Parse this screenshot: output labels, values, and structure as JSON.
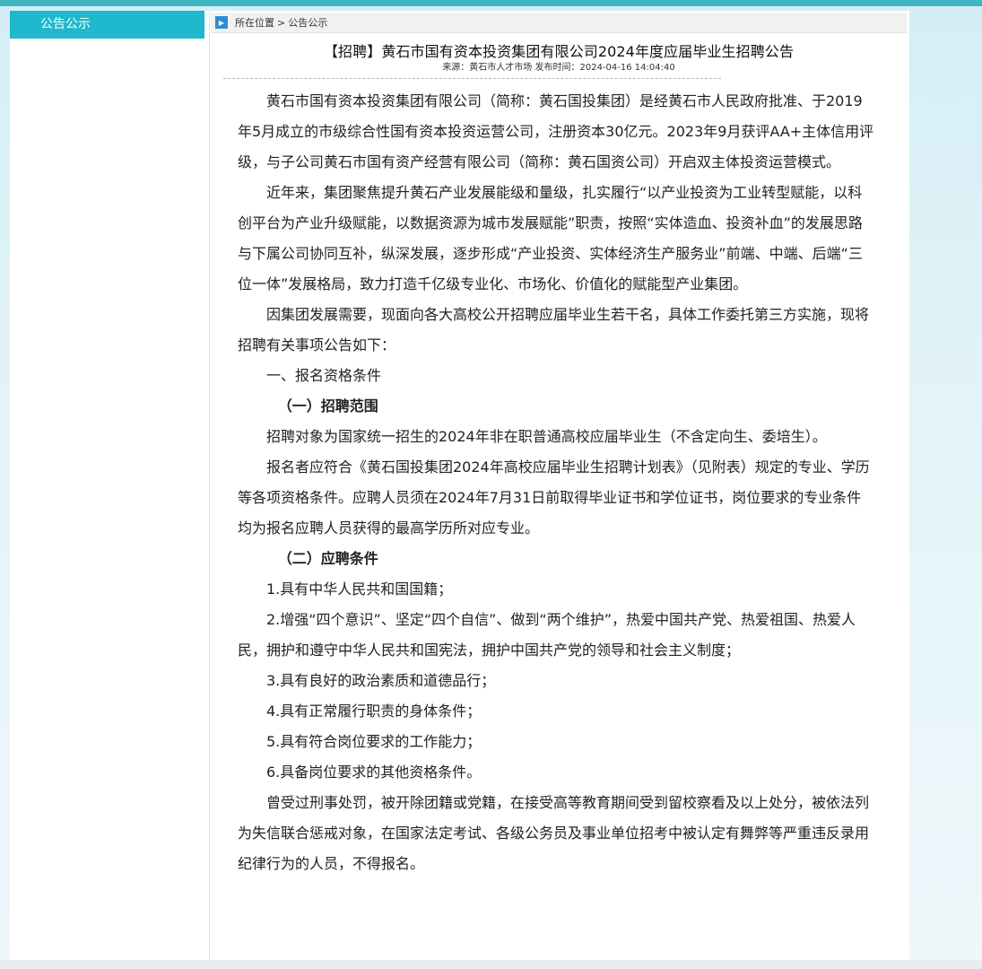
{
  "sidebar": {
    "items": [
      {
        "label": "公告公示"
      }
    ]
  },
  "breadcrumb": {
    "icon": "play-icon",
    "location": "所在位置",
    "separator": ">",
    "current": "公告公示"
  },
  "article": {
    "title": "【招聘】黄石市国有资本投资集团有限公司2024年度应届毕业生招聘公告",
    "source_label": "来源：",
    "source": "黄石市人才市场",
    "published_label": "发布时间：",
    "published": "2024-04-16 14:04:40",
    "paragraphs": [
      "黄石市国有资本投资集团有限公司（简称：黄石国投集团）是经黄石市人民政府批准、于2019年5月成立的市级综合性国有资本投资运营公司，注册资本30亿元。2023年9月获评AA+主体信用评级，与子公司黄石市国有资产经营有限公司（简称：黄石国资公司）开启双主体投资运营模式。",
      "近年来，集团聚焦提升黄石产业发展能级和量级，扎实履行“以产业投资为工业转型赋能，以科创平台为产业升级赋能，以数据资源为城市发展赋能”职责，按照“实体造血、投资补血”的发展思路与下属公司协同互补，纵深发展，逐步形成“产业投资、实体经济生产服务业”前端、中端、后端“三位一体”发展格局，致力打造千亿级专业化、市场化、价值化的赋能型产业集团。",
      "因集团发展需要，现面向各大高校公开招聘应届毕业生若干名，具体工作委托第三方实施，现将招聘有关事项公告如下：",
      "一、报名资格条件",
      "（一）招聘范围",
      "招聘对象为国家统一招生的2024年非在职普通高校应届毕业生（不含定向生、委培生）。",
      "报名者应符合《黄石国投集团2024年高校应届毕业生招聘计划表》（见附表）规定的专业、学历等各项资格条件。应聘人员须在2024年7月31日前取得毕业证书和学位证书，岗位要求的专业条件均为报名应聘人员获得的最高学历所对应专业。",
      "（二）应聘条件",
      "1.具有中华人民共和国国籍；",
      "2.增强“四个意识”、坚定“四个自信”、做到“两个维护”，热爱中国共产党、热爱祖国、热爱人民，拥护和遵守中华人民共和国宪法，拥护中国共产党的领导和社会主义制度；",
      "3.具有良好的政治素质和道德品行；",
      "4.具有正常履行职责的身体条件；",
      "5.具有符合岗位要求的工作能力；",
      "6.具备岗位要求的其他资格条件。",
      "曾受过刑事处罚，被开除团籍或党籍，在接受高等教育期间受到留校察看及以上处分，被依法列为失信联合惩戒对象，在国家法定考试、各级公务员及事业单位招考中被认定有舞弊等严重违反录用纪律行为的人员，不得报名。"
    ]
  }
}
